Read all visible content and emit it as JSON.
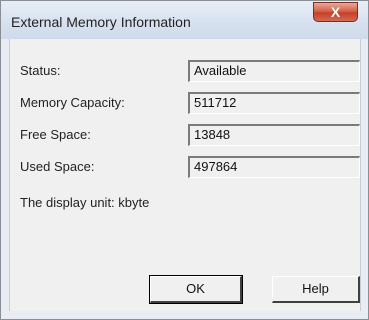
{
  "window": {
    "title": "External Memory Information",
    "close_label": "X"
  },
  "fields": [
    {
      "label": "Status:",
      "value": "Available"
    },
    {
      "label": "Memory Capacity:",
      "value": "511712"
    },
    {
      "label": "Free Space:",
      "value": "13848"
    },
    {
      "label": "Used Space:",
      "value": "497864"
    }
  ],
  "unit_note": "The display unit: kbyte",
  "buttons": {
    "ok": "OK",
    "help": "Help"
  }
}
